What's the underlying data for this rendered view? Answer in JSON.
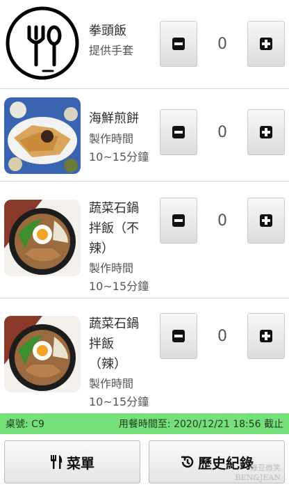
{
  "menu_items": [
    {
      "name": "拳頭飯",
      "desc": [
        "提供手套"
      ],
      "qty": "0",
      "image": "utensils-logo-icon"
    },
    {
      "name": "海鮮煎餅",
      "desc": [
        "製作時間",
        "10~15分鐘"
      ],
      "qty": "0",
      "image": "seafood-pancake-photo"
    },
    {
      "name_lines": [
        "蔬菜石鍋",
        "拌飯（不",
        "辣）"
      ],
      "desc": [
        "製作時間",
        "10~15分鐘"
      ],
      "qty": "0",
      "image": "bibimbap-photo"
    },
    {
      "name_lines": [
        "蔬菜石鍋",
        "拌飯",
        "（辣）"
      ],
      "desc": [
        "製作時間",
        "10~15分鐘"
      ],
      "qty": "0",
      "image": "bibimbap-spicy-photo"
    }
  ],
  "status_bar": {
    "table_label": "桌號: C9",
    "time_label": "用餐時間至: 2020/12/21 18:56 截止",
    "color": "#75e07a"
  },
  "bottom_nav": {
    "menu_label": "菜單",
    "history_label": "歷史紀錄"
  },
  "watermark": [
    "綠豆微笑",
    "BEN&JEAN"
  ]
}
